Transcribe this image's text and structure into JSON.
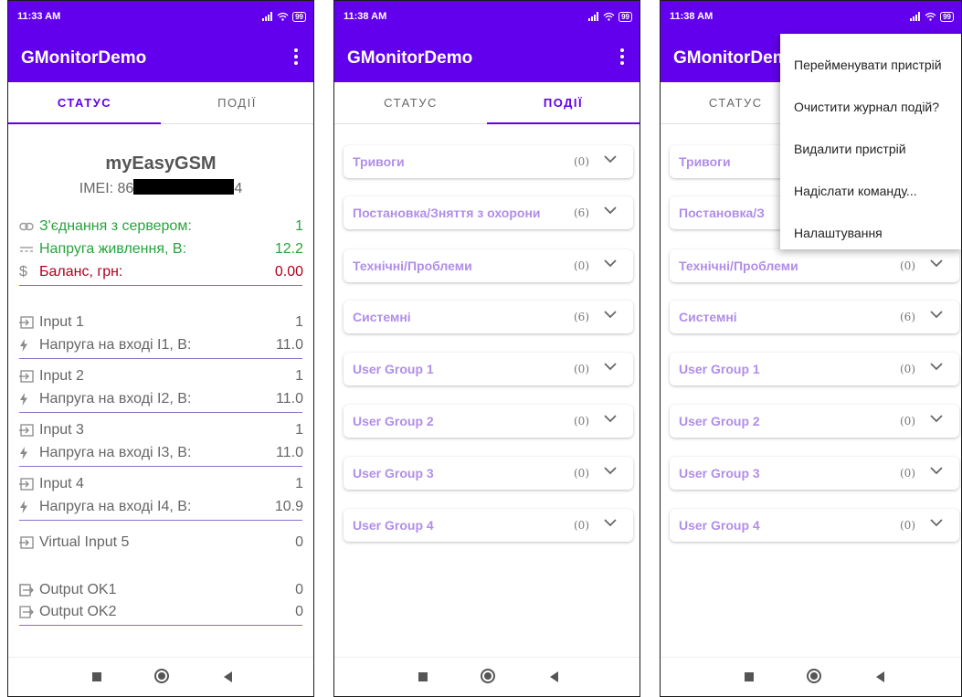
{
  "status_bar": {
    "time_left": "11:33 AM",
    "time_right": "11:38 AM",
    "battery": "99"
  },
  "app": {
    "title": "GMonitorDemo",
    "title_cut": "GMonitorDem"
  },
  "tabs": {
    "status": "СТАТУС",
    "events": "ПОДІЇ"
  },
  "device": {
    "name": "myEasyGSM",
    "imei_prefix": "IMEI: 86",
    "imei_suffix": "4",
    "server_label": "З'єднання з сервером:",
    "server_value": "1",
    "power_label": "Напруга живлення, В:",
    "power_value": "12.2",
    "balance_label": "Баланс, грн:",
    "balance_value": "0.00"
  },
  "inputs": [
    {
      "name": "Input 1",
      "state": "1",
      "voltage_label": "Напруга на вході І1, В:",
      "voltage": "11.0"
    },
    {
      "name": "Input 2",
      "state": "1",
      "voltage_label": "Напруга на вході І2, В:",
      "voltage": "11.0"
    },
    {
      "name": "Input 3",
      "state": "1",
      "voltage_label": "Напруга на вході І3, В:",
      "voltage": "11.0"
    },
    {
      "name": "Input 4",
      "state": "1",
      "voltage_label": "Напруга на вході І4, В:",
      "voltage": "10.9"
    }
  ],
  "virtual_input": {
    "name": "Virtual Input 5",
    "state": "0"
  },
  "outputs": [
    {
      "name": "Output OK1",
      "state": "0"
    },
    {
      "name": "Output OK2",
      "state": "0"
    }
  ],
  "event_groups": [
    {
      "name": "Тривоги",
      "name_cut": "Тривоги",
      "count": "(0)"
    },
    {
      "name": "Постановка/Зняття з охорони",
      "name_cut": "Постановка/З",
      "count": "(6)"
    },
    {
      "name": "Технічні/Проблеми",
      "name_cut": "Технічні/Проблеми",
      "count": "(0)"
    },
    {
      "name": "Системні",
      "name_cut": "Системні",
      "count": "(6)"
    },
    {
      "name": "User Group 1",
      "name_cut": "User Group 1",
      "count": "(0)"
    },
    {
      "name": "User Group 2",
      "name_cut": "User Group 2",
      "count": "(0)"
    },
    {
      "name": "User Group 3",
      "name_cut": "User Group 3",
      "count": "(0)"
    },
    {
      "name": "User Group 4",
      "name_cut": "User Group 4",
      "count": "(0)"
    }
  ],
  "overflow_menu": [
    "Перейменувати пристрій",
    "Очистити журнал подій?",
    "Видалити пристрій",
    "Надіслати команду...",
    "Налаштування"
  ],
  "colors": {
    "primary": "#6200ee",
    "green": "#27a33c",
    "red": "#b00020",
    "group_text": "#b08ee8"
  },
  "icons": [
    "link-icon",
    "dc-power-icon",
    "dollar-icon",
    "input-icon",
    "bolt-icon",
    "output-icon",
    "chevron-down-icon",
    "kebab-menu-icon"
  ]
}
